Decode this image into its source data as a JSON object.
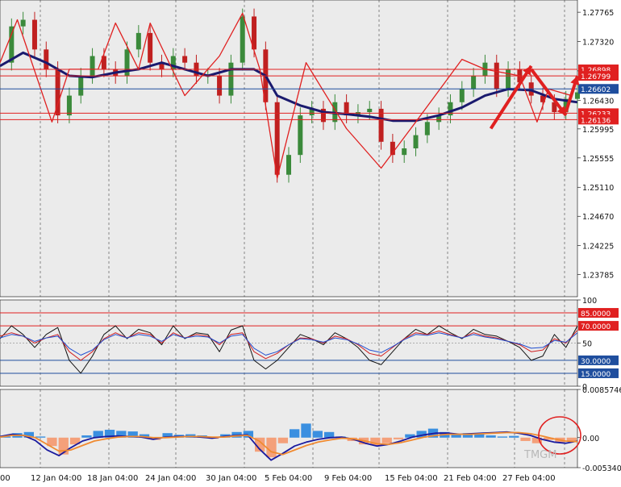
{
  "chart_data": [
    {
      "type": "line",
      "panel": "price",
      "title": "",
      "xlabel": "",
      "ylabel": "",
      "ylim": [
        1.2345,
        1.2795
      ],
      "yticks": [
        "1.27765",
        "1.27320",
        "1.26875",
        "1.26430",
        "1.25995",
        "1.25555",
        "1.25110",
        "1.24670",
        "1.24225",
        "1.23785"
      ],
      "xlim": [
        0,
        100
      ],
      "series": [
        {
          "name": "",
          "role": "price",
          "color": "#6b1818",
          "x": [
            0,
            2,
            4,
            6,
            8,
            10,
            12,
            14,
            16,
            18,
            20,
            22,
            24,
            26,
            28,
            30,
            32,
            34,
            36,
            38,
            40,
            42,
            44,
            46,
            48,
            50,
            52,
            54,
            56,
            58,
            60,
            62,
            64,
            66,
            68,
            70,
            72,
            74,
            76,
            78,
            80,
            82,
            84,
            86,
            88,
            90,
            92,
            94,
            96,
            98,
            100
          ],
          "values": [
            1.27,
            1.2755,
            1.2765,
            1.272,
            1.269,
            1.262,
            1.265,
            1.268,
            1.271,
            1.269,
            1.268,
            1.272,
            1.2745,
            1.27,
            1.269,
            1.271,
            1.27,
            1.268,
            1.268,
            1.265,
            1.27,
            1.277,
            1.272,
            1.264,
            1.253,
            1.256,
            1.262,
            1.263,
            1.261,
            1.264,
            1.262,
            1.2625,
            1.263,
            1.258,
            1.256,
            1.257,
            1.259,
            1.261,
            1.262,
            1.264,
            1.266,
            1.268,
            1.27,
            1.266,
            1.269,
            1.267,
            1.265,
            1.264,
            1.2625,
            1.2645,
            1.2655
          ]
        },
        {
          "name": "",
          "role": "moving-average",
          "color": "#1a1a6e",
          "x": [
            0,
            4,
            8,
            12,
            16,
            20,
            24,
            28,
            32,
            36,
            40,
            44,
            46,
            48,
            52,
            56,
            60,
            64,
            68,
            72,
            76,
            80,
            84,
            88,
            92,
            96,
            100
          ],
          "values": [
            1.2695,
            1.2715,
            1.27,
            1.268,
            1.2678,
            1.2685,
            1.269,
            1.27,
            1.269,
            1.268,
            1.269,
            1.269,
            1.268,
            1.265,
            1.2635,
            1.2625,
            1.2622,
            1.2618,
            1.2612,
            1.2612,
            1.262,
            1.2632,
            1.265,
            1.266,
            1.2658,
            1.2645,
            1.264
          ]
        },
        {
          "name": "",
          "role": "zigzag",
          "color": "#e02020",
          "x": [
            0,
            3,
            9,
            12,
            17,
            20,
            24,
            26,
            32,
            38,
            42,
            45,
            48,
            53,
            60,
            66,
            72,
            80,
            84,
            90,
            93,
            95,
            99
          ],
          "values": [
            1.27,
            1.2765,
            1.261,
            1.269,
            1.269,
            1.276,
            1.269,
            1.276,
            1.265,
            1.271,
            1.2775,
            1.269,
            1.2525,
            1.27,
            1.26,
            1.254,
            1.261,
            1.2705,
            1.269,
            1.268,
            1.261,
            1.266,
            1.265
          ]
        }
      ],
      "hlines": [
        {
          "value": 1.26898,
          "label": "1.26898",
          "color": "#e02020"
        },
        {
          "value": 1.26799,
          "label": "1.26799",
          "color": "#e02020"
        },
        {
          "value": 1.26602,
          "label": "1.26602",
          "color": "#1f4e9e"
        },
        {
          "value": 1.26233,
          "label": "1.26233",
          "color": "#e02020"
        },
        {
          "value": 1.26136,
          "label": "1.26136",
          "color": "#e02020"
        }
      ],
      "arrows": [
        {
          "from": [
            85,
            1.26
          ],
          "to": [
            92,
            1.2695
          ],
          "color": "#e02020"
        },
        {
          "from": [
            92,
            1.269
          ],
          "to": [
            98,
            1.262
          ],
          "color": "#e02020"
        },
        {
          "from": [
            98,
            1.2625
          ],
          "to": [
            100,
            1.268
          ],
          "color": "#e02020"
        }
      ],
      "grid": true
    },
    {
      "type": "line",
      "panel": "oscillator",
      "ylim": [
        0,
        100
      ],
      "yticks": [
        "100",
        "50",
        "0"
      ],
      "hlines": [
        {
          "value": 85,
          "label": "85.0000",
          "color": "#e02020"
        },
        {
          "value": 70,
          "label": "70.0000",
          "color": "#e02020"
        },
        {
          "value": 30,
          "label": "30.0000",
          "color": "#1f4e9e"
        },
        {
          "value": 15,
          "label": "15.0000",
          "color": "#1f4e9e"
        }
      ],
      "series": [
        {
          "name": "",
          "color": "#111111",
          "values": [
            55,
            70,
            60,
            45,
            60,
            68,
            30,
            15,
            35,
            60,
            70,
            55,
            66,
            62,
            48,
            70,
            55,
            62,
            60,
            40,
            65,
            70,
            30,
            20,
            30,
            45,
            60,
            55,
            48,
            62,
            55,
            45,
            30,
            25,
            40,
            55,
            66,
            60,
            70,
            62,
            55,
            66,
            60,
            58,
            52,
            45,
            30,
            35,
            60,
            45,
            70
          ]
        },
        {
          "name": "",
          "color": "#d02020",
          "values": [
            58,
            62,
            58,
            50,
            56,
            60,
            40,
            30,
            40,
            55,
            62,
            56,
            62,
            60,
            50,
            62,
            56,
            60,
            58,
            48,
            60,
            62,
            40,
            32,
            38,
            48,
            56,
            55,
            50,
            58,
            55,
            48,
            38,
            35,
            45,
            55,
            62,
            60,
            64,
            60,
            56,
            62,
            58,
            56,
            52,
            48,
            40,
            42,
            55,
            50,
            65
          ]
        },
        {
          "name": "",
          "color": "#1f4ed0",
          "values": [
            56,
            60,
            58,
            52,
            56,
            58,
            44,
            36,
            42,
            54,
            60,
            56,
            60,
            58,
            52,
            60,
            56,
            58,
            57,
            50,
            58,
            60,
            44,
            36,
            40,
            48,
            55,
            54,
            51,
            56,
            54,
            49,
            42,
            39,
            46,
            54,
            60,
            59,
            62,
            59,
            56,
            60,
            57,
            55,
            52,
            49,
            44,
            45,
            53,
            51,
            62
          ]
        }
      ]
    },
    {
      "type": "bar",
      "panel": "macd",
      "ylim": [
        -0.0053404,
        0.0085746
      ],
      "yticks": [
        "0.0085746",
        "0.00",
        "-0.0053404"
      ],
      "histogram": [
        0.0002,
        0.0008,
        0.001,
        0.0002,
        -0.0015,
        -0.003,
        -0.0012,
        0.0004,
        0.0012,
        0.0014,
        0.0012,
        0.0011,
        0.0006,
        -0.0004,
        0.0008,
        0.0005,
        0.0006,
        0.0004,
        -0.0002,
        0.0006,
        0.001,
        0.0012,
        -0.0025,
        -0.0035,
        -0.001,
        0.0015,
        0.0025,
        0.0012,
        0.001,
        0.0002,
        -0.0006,
        -0.0012,
        -0.0014,
        -0.001,
        -0.0003,
        0.0006,
        0.0012,
        0.0016,
        0.001,
        0.0006,
        0.0008,
        0.0006,
        0.0004,
        0.0002,
        0.0003,
        -0.0006,
        -0.001,
        -0.0004,
        -0.0008,
        -0.0006
      ],
      "series": [
        {
          "name": "",
          "color": "#1a1a9e",
          "values": [
            0.0002,
            0.0006,
            0.0004,
            -0.0005,
            -0.0022,
            -0.0032,
            -0.0018,
            -0.0006,
            0.0,
            0.0002,
            0.0003,
            0.0002,
            0.0001,
            -0.0003,
            0.0001,
            0.0002,
            0.0002,
            0.0001,
            -0.0001,
            0.0002,
            0.0004,
            0.0005,
            -0.002,
            -0.004,
            -0.0028,
            -0.0015,
            -0.0008,
            -0.0003,
            0.0,
            0.0001,
            -0.0003,
            -0.001,
            -0.0015,
            -0.0012,
            -0.0006,
            0.0001,
            0.0005,
            0.0008,
            0.0008,
            0.0006,
            0.0007,
            0.0008,
            0.0009,
            0.001,
            0.0008,
            0.0004,
            -0.0003,
            -0.0008,
            -0.001,
            -0.0006
          ]
        },
        {
          "name": "",
          "color": "#f08a30",
          "values": [
            0.0001,
            0.0004,
            0.0004,
            0.0,
            -0.0012,
            -0.0024,
            -0.0022,
            -0.0014,
            -0.0006,
            -0.0002,
            0.0001,
            0.0002,
            0.0002,
            0.0,
            0.0,
            0.0001,
            0.0002,
            0.0002,
            0.0001,
            0.0001,
            0.0003,
            0.0004,
            -0.0006,
            -0.0025,
            -0.003,
            -0.0022,
            -0.0014,
            -0.0008,
            -0.0004,
            -0.0001,
            -0.0002,
            -0.0006,
            -0.0011,
            -0.0012,
            -0.0009,
            -0.0004,
            0.0001,
            0.0004,
            0.0006,
            0.0006,
            0.0006,
            0.0007,
            0.0008,
            0.0009,
            0.0009,
            0.0007,
            0.0003,
            -0.0002,
            -0.0006,
            -0.0007
          ]
        }
      ]
    }
  ],
  "x_axis_labels": [
    "00",
    "12 Jan 04:00",
    "18 Jan 04:00",
    "24 Jan 04:00",
    "30 Jan 04:00",
    "5 Feb 04:00",
    "9 Feb 04:00",
    "15 Feb 04:00",
    "21 Feb 04:00",
    "27 Feb 04:00"
  ],
  "watermark": "TMGM",
  "colors": {
    "background": "#ebebeb",
    "bull": "#3b8a3b",
    "bear": "#c02020",
    "hist_pos": "#3a8fe0",
    "hist_neg": "#f4a07a",
    "circle": "#e02020"
  }
}
